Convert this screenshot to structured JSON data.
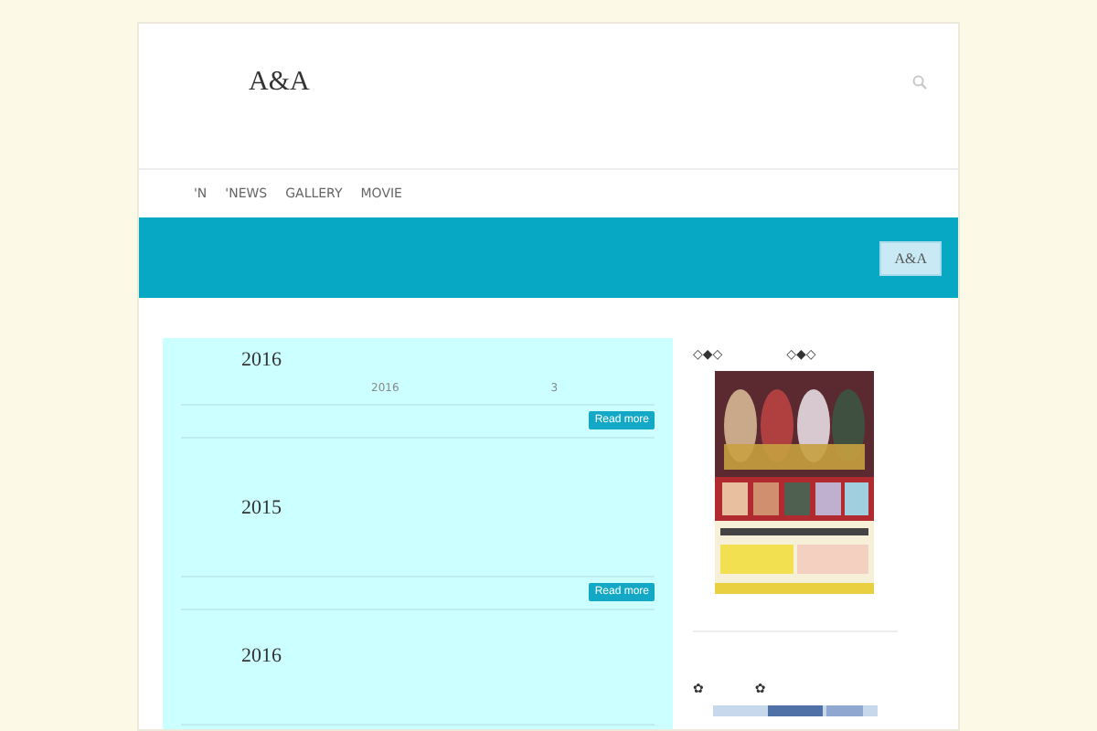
{
  "site": {
    "logo": "A&A"
  },
  "nav": [
    {
      "label": "'N"
    },
    {
      "label": "'NEWS"
    },
    {
      "label": "GALLERY"
    },
    {
      "label": "MOVIE"
    }
  ],
  "banner": {
    "button": "A&A"
  },
  "posts": [
    {
      "title": "2016",
      "meta": [
        "2016",
        "3"
      ],
      "button": "Read more"
    },
    {
      "title": "2015",
      "button": "Read more"
    },
    {
      "title": "2016"
    }
  ],
  "sidebar": [
    {
      "title": "◇◆◇　　　　　◇◆◇",
      "kind": "poster"
    },
    {
      "title": "✿　　　　✿"
    }
  ]
}
